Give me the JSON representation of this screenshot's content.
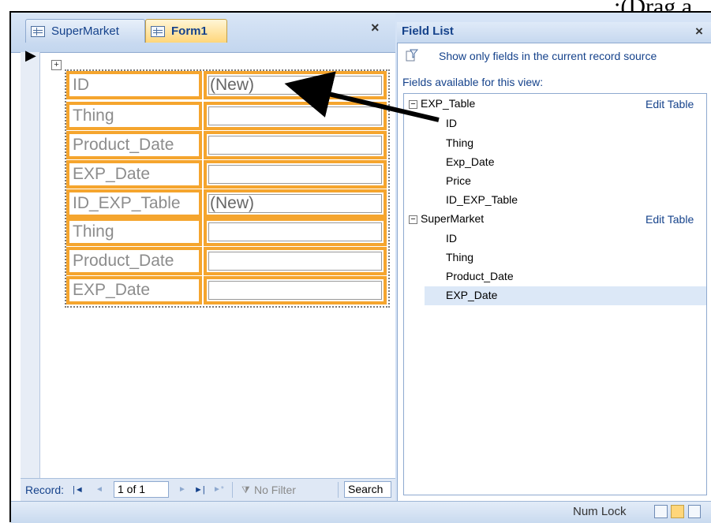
{
  "caption": ":(Drag a",
  "tabs": [
    {
      "label": "SuperMarket",
      "icon": "table-icon",
      "active": false
    },
    {
      "label": "Form1",
      "icon": "form-icon",
      "active": true
    }
  ],
  "close_symbol": "×",
  "form": {
    "rows": [
      {
        "label": "ID",
        "value": "(New)"
      },
      {
        "label": "Thing",
        "value": ""
      },
      {
        "label": "Product_Date",
        "value": ""
      },
      {
        "label": "EXP_Date",
        "value": ""
      },
      {
        "label": "ID_EXP_Table",
        "value": "(New)"
      },
      {
        "label": "Thing",
        "value": ""
      },
      {
        "label": "Product_Date",
        "value": ""
      },
      {
        "label": "EXP_Date",
        "value": ""
      }
    ]
  },
  "navigation": {
    "record_label": "Record:",
    "first": "|◄",
    "prev": "◄",
    "counter": "1 of 1",
    "next": "►",
    "last": "►|",
    "new": "►*",
    "filter_label": "No Filter",
    "search_placeholder": "Search"
  },
  "field_list": {
    "title": "Field List",
    "show_only": "Show only fields in the current record source",
    "available_label": "Fields available for this view:",
    "edit_label": "Edit Table",
    "groups": [
      {
        "name": "EXP_Table",
        "expander": "−",
        "fields": [
          "ID",
          "Thing",
          "Exp_Date",
          "Price",
          "ID_EXP_Table"
        ]
      },
      {
        "name": "SuperMarket",
        "expander": "−",
        "fields": [
          "ID",
          "Thing",
          "Product_Date",
          "EXP_Date"
        ]
      }
    ],
    "selected_field": "EXP_Date"
  },
  "statusbar": {
    "num_lock": "Num Lock"
  },
  "colors": {
    "label_border": "#f5a52e",
    "ribbon_blue": "#d5e3f6",
    "text_blue": "#15428b",
    "selection": "#dce8f7"
  }
}
